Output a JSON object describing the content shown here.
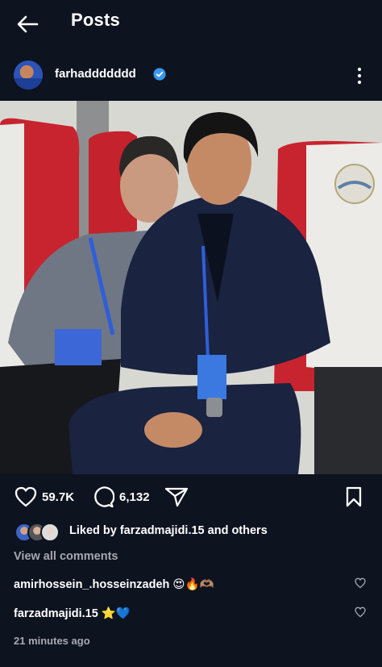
{
  "header": {
    "title": "Posts"
  },
  "post": {
    "username": "farhaddddddd",
    "likes": "59.7K",
    "comments_count": "6,132",
    "liked_by": "Liked by farzadmajidi.15 and others",
    "view_all": "View all comments",
    "timestamp": "21 minutes ago"
  },
  "comments": [
    {
      "text": "amirhossein_.hosseinzadeh 😍🔥🫶🏽"
    },
    {
      "text": "farzadmajidi.15 ⭐💙"
    }
  ],
  "colors": {
    "background": "#0e1320",
    "verified": "#3797f0",
    "seat_red": "#c8242f",
    "suit": "#1a2340"
  }
}
